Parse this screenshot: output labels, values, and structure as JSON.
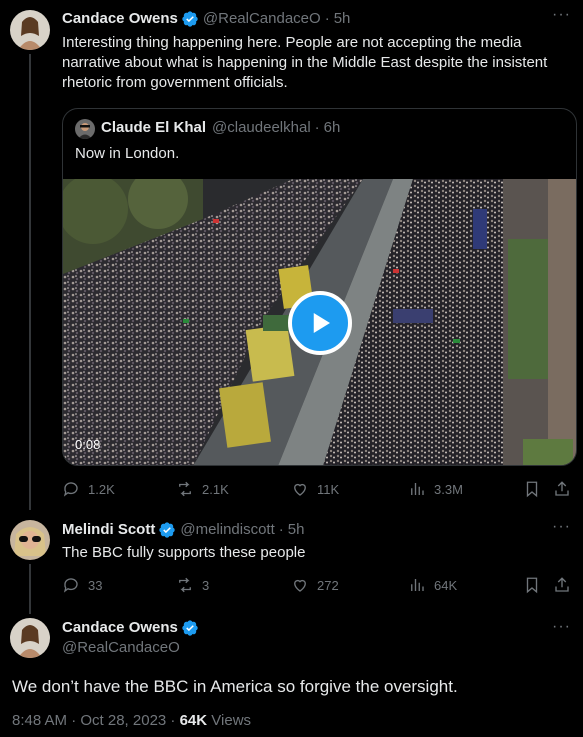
{
  "tweet1": {
    "name": "Candace Owens",
    "handle": "@RealCandaceO",
    "separator": "·",
    "time": "5h",
    "text": "Interesting thing happening here. People are not accepting the media narrative about what is happening in the Middle East despite the insistent rhetoric from government officials.",
    "quote": {
      "name": "Claude El Khal",
      "handle": "@claudeelkhal",
      "separator": "·",
      "time": "6h",
      "text": "Now in London.",
      "duration": "0:08"
    },
    "replies": "1.2K",
    "reposts": "2.1K",
    "likes": "11K",
    "views": "3.3M"
  },
  "tweet2": {
    "name": "Melindi Scott",
    "handle": "@melindiscott",
    "separator": "·",
    "time": "5h",
    "text": "The BBC fully supports these people",
    "replies": "33",
    "reposts": "3",
    "likes": "272",
    "views": "64K"
  },
  "tweet3": {
    "name": "Candace Owens",
    "handle": "@RealCandaceO",
    "text": "We don’t have the BBC in America so forgive the oversight.",
    "timestamp": "8:48 AM · Oct 28, 2023 · ",
    "view_count": "64K",
    "views_label": " Views"
  },
  "more_label": "···",
  "colors": {
    "accent": "#1d9bf0",
    "muted": "#71767b",
    "text": "#e7e9ea",
    "border": "#2f3336"
  },
  "icons": [
    "reply-icon",
    "repost-icon",
    "like-icon",
    "views-icon",
    "bookmark-icon",
    "share-icon",
    "verified-icon",
    "play-icon"
  ]
}
